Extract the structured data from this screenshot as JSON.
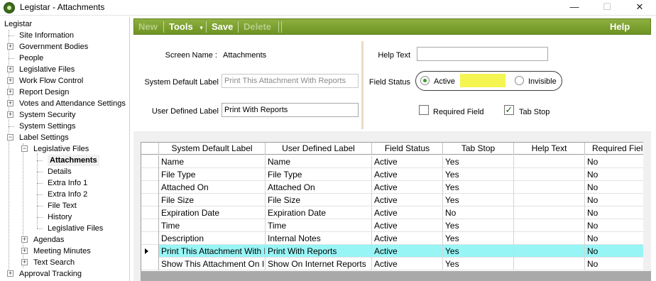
{
  "window": {
    "title": "Legistar - Attachments",
    "minimize": "—",
    "maximize": "☐",
    "close": "✕"
  },
  "tree": {
    "root": "Legistar",
    "items": [
      {
        "label": "Site Information",
        "expandable": false
      },
      {
        "label": "Government Bodies",
        "expandable": true
      },
      {
        "label": "People",
        "expandable": false
      },
      {
        "label": "Legislative Files",
        "expandable": true
      },
      {
        "label": "Work Flow Control",
        "expandable": true
      },
      {
        "label": "Report Design",
        "expandable": true
      },
      {
        "label": "Votes and Attendance Settings",
        "expandable": true
      },
      {
        "label": "System Security",
        "expandable": true
      },
      {
        "label": "System Settings",
        "expandable": false
      },
      {
        "label": "Label Settings",
        "expandable": true,
        "expanded": true
      }
    ],
    "label_settings_children": {
      "legislative_files": "Legislative Files",
      "sub_items": [
        "Attachments",
        "Details",
        "Extra Info 1",
        "Extra Info 2",
        "File Text",
        "History",
        "Legislative Files"
      ],
      "agendas": "Agendas",
      "meeting_minutes": "Meeting Minutes",
      "text_search": "Text Search"
    },
    "approval_tracking": "Approval Tracking",
    "selected": "Attachments"
  },
  "toolbar": {
    "new": "New",
    "tools": "Tools",
    "tools_caret": "▾",
    "save": "Save",
    "delete": "Delete",
    "help": "Help"
  },
  "form": {
    "screen_name_label": "Screen Name :",
    "screen_name_value": "Attachments",
    "system_default_label": "System Default Label",
    "system_default_value": "Print This Attachment With Reports",
    "user_defined_label": "User Defined Label",
    "user_defined_value": "Print With Reports",
    "help_text_label": "Help Text",
    "help_text_value": "",
    "field_status_label": "Field Status",
    "status_active": "Active",
    "status_invisible": "Invisible",
    "status_selected": "Active",
    "required_field_label": "Required Field",
    "required_field_checked": false,
    "tab_stop_label": "Tab Stop",
    "tab_stop_checked": true,
    "highlight_color": "#f5f552"
  },
  "grid": {
    "columns": [
      "System Default Label",
      "User Defined Label",
      "Field Status",
      "Tab Stop",
      "Help Text",
      "Required Field"
    ],
    "rows": [
      {
        "system": "Name",
        "user": "Name",
        "status": "Active",
        "tab": "Yes",
        "help": "",
        "required": "No"
      },
      {
        "system": "File Type",
        "user": "File Type",
        "status": "Active",
        "tab": "Yes",
        "help": "",
        "required": "No"
      },
      {
        "system": "Attached On",
        "user": "Attached On",
        "status": "Active",
        "tab": "Yes",
        "help": "",
        "required": "No"
      },
      {
        "system": "File Size",
        "user": "File Size",
        "status": "Active",
        "tab": "Yes",
        "help": "",
        "required": "No"
      },
      {
        "system": "Expiration Date",
        "user": "Expiration Date",
        "status": "Active",
        "tab": "No",
        "help": "",
        "required": "No"
      },
      {
        "system": "Time",
        "user": "Time",
        "status": "Active",
        "tab": "Yes",
        "help": "",
        "required": "No"
      },
      {
        "system": "Description",
        "user": "Internal Notes",
        "status": "Active",
        "tab": "Yes",
        "help": "",
        "required": "No"
      },
      {
        "system": "Print This Attachment With Reports",
        "user": "Print With Reports",
        "status": "Active",
        "tab": "Yes",
        "help": "",
        "required": "No",
        "selected": true
      },
      {
        "system": "Show This Attachment On Internet",
        "user": "Show On Internet Reports",
        "status": "Active",
        "tab": "Yes",
        "help": "",
        "required": "No"
      }
    ],
    "selected_row_color": "#98f5f6"
  },
  "colors": {
    "toolbar_green": "#7aa02c",
    "accent": "#3a9a2a"
  }
}
